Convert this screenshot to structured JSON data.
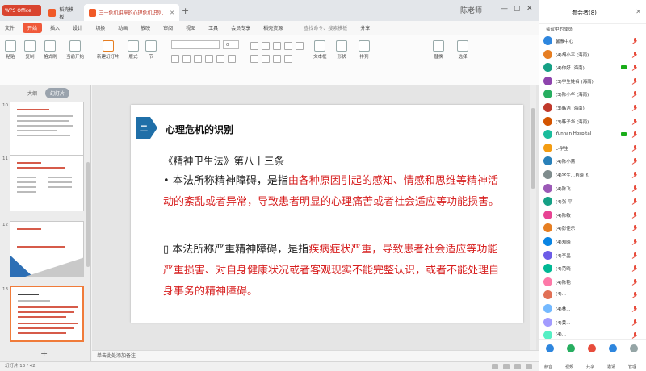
{
  "window": {
    "app_logo": "WPS Office",
    "tabs": [
      {
        "label": "稻壳模板",
        "icon_color": "#f05a28"
      },
      {
        "label": "三一危机讲座的心理危机识别.pptx",
        "icon_color": "#f05a28"
      }
    ],
    "user": "陈老师"
  },
  "menubar": {
    "items": [
      "文件",
      "开始",
      "插入",
      "设计",
      "切换",
      "动画",
      "放映",
      "审阅",
      "视图",
      "工具",
      "会员专享",
      "稻壳资源"
    ],
    "active_index": 1,
    "search": "查找命令、搜索模板",
    "share": "分享"
  },
  "toolbar": {
    "buttons": [
      "粘贴",
      "复制",
      "格式刷",
      "当前开始",
      "新建幻灯片",
      "版式",
      "节",
      "重置"
    ],
    "font_name": "",
    "font_size": "0",
    "text_tools": "文本框",
    "shape_tools": "形状",
    "arrange": "排列",
    "replace": "替换",
    "select": "选择"
  },
  "slides_panel": {
    "tabs": [
      "大纲",
      "幻灯片"
    ],
    "active_tab": 1,
    "slide_numbers": [
      "10",
      "11",
      "12",
      "13"
    ],
    "add_label": "+"
  },
  "slide": {
    "badge": "二",
    "badge_color": "#1f6fa8",
    "title": "心理危机的识别",
    "law_title": "《精神卫生法》第八十三条",
    "para1_black": "本法所称精神障碍，是指",
    "para1_red": "由各种原因引起的感知、情感和思维等精神活动的紊乱或者异常，导致患者明显的心理痛苦或者社会适应等功能损害。",
    "para2_black": "本法所称严重精神障碍，是指",
    "para2_red": "疾病症状严重，导致患者社会适应等功能严重损害、对自身健康状况或者客观现实不能完整认识，或者不能处理自身事务的精神障碍。",
    "red_color": "#d71f1f"
  },
  "notes": {
    "text": "单击此处添加备注"
  },
  "statusbar": {
    "text": "幻灯片 13 / 42"
  },
  "participants": {
    "title": "参会者(8)",
    "subtitle": "会议中的成员",
    "list": [
      {
        "name": "馨雅中心",
        "color": "#2e86de"
      },
      {
        "name": "(4)胡小平 (海南)",
        "color": "#e67e22"
      },
      {
        "name": "(4)你好 (海南)",
        "color": "#16a085"
      },
      {
        "name": "(3)学生姓名 (海南)",
        "color": "#8e44ad"
      },
      {
        "name": "(3)陈小华 (海南)",
        "color": "#27ae60"
      },
      {
        "name": "(3)韩浩 (海南)",
        "color": "#c0392b"
      },
      {
        "name": "(3)韩子华 (海南)",
        "color": "#d35400"
      },
      {
        "name": "Yunnan Hospital",
        "color": "#1abc9c"
      },
      {
        "name": "c-学生",
        "color": "#f39c12"
      },
      {
        "name": "(4)陈小燕",
        "color": "#2980b9"
      },
      {
        "name": "(4)学生...肖晓飞",
        "color": "#7f8c8d"
      },
      {
        "name": "(4)陈飞",
        "color": "#9b59b6"
      },
      {
        "name": "(4)张-平",
        "color": "#16a085"
      },
      {
        "name": "(4)陈敏",
        "color": "#e84393"
      },
      {
        "name": "(4)彭佳乐",
        "color": "#e67e22"
      },
      {
        "name": "(4)郑晓",
        "color": "#0984e3"
      },
      {
        "name": "(4)李晶",
        "color": "#6c5ce7"
      },
      {
        "name": "(4)范晓",
        "color": "#00b894"
      },
      {
        "name": "(4)陈艳",
        "color": "#fd79a8"
      },
      {
        "name": "(4)...",
        "color": "#e17055"
      },
      {
        "name": "(4)林...",
        "color": "#74b9ff"
      },
      {
        "name": "(4)黄...",
        "color": "#a29bfe"
      },
      {
        "name": "(4)...",
        "color": "#55efc4"
      }
    ],
    "footer": [
      "静音",
      "视频",
      "共享",
      "邀请",
      "管理"
    ]
  }
}
